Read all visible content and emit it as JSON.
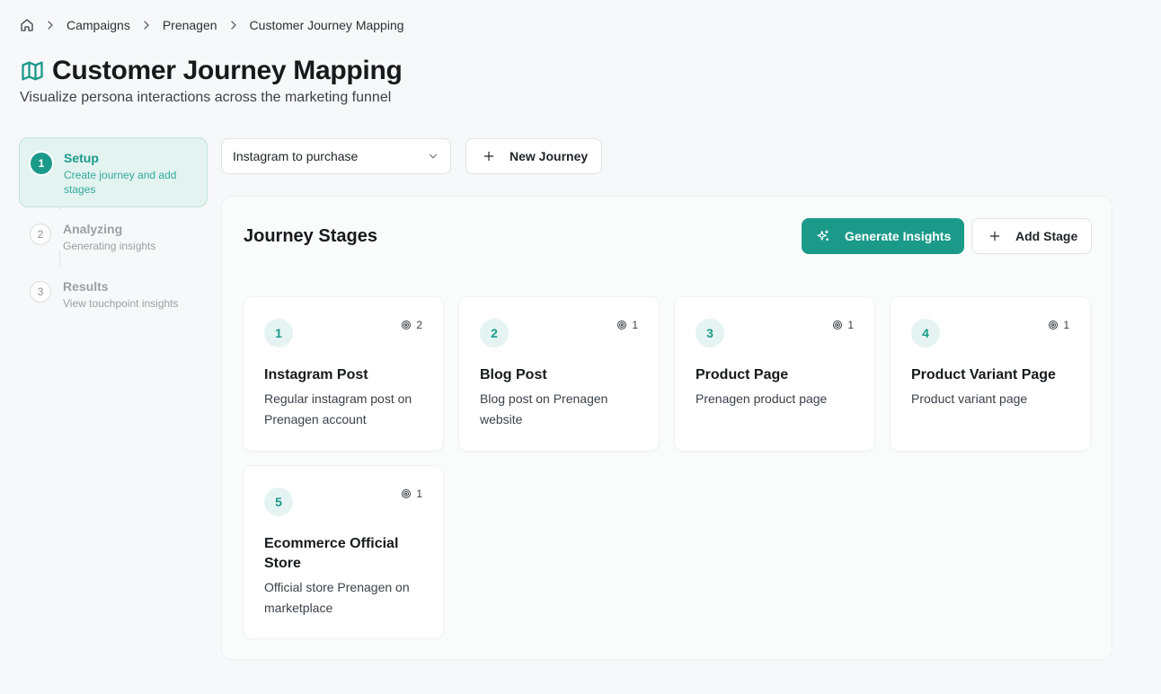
{
  "breadcrumb": {
    "home_icon": "home-icon",
    "items": [
      "Campaigns",
      "Prenagen",
      "Customer Journey Mapping"
    ]
  },
  "header": {
    "icon": "map-icon",
    "title": "Customer Journey Mapping",
    "subtitle": "Visualize persona interactions across the marketing funnel"
  },
  "stepper": {
    "steps": [
      {
        "number": "1",
        "label": "Setup",
        "description": "Create journey and add stages",
        "state": "active"
      },
      {
        "number": "2",
        "label": "Analyzing",
        "description": "Generating insights",
        "state": "pending"
      },
      {
        "number": "3",
        "label": "Results",
        "description": "View touchpoint insights",
        "state": "pending"
      }
    ]
  },
  "controls": {
    "journey_select_value": "Instagram to purchase",
    "new_journey_label": "New Journey"
  },
  "panel": {
    "title": "Journey Stages",
    "generate_insights_label": "Generate Insights",
    "add_stage_label": "Add Stage"
  },
  "stages": [
    {
      "number": "1",
      "count": "2",
      "title": "Instagram Post",
      "description": "Regular instagram post on Prenagen account"
    },
    {
      "number": "2",
      "count": "1",
      "title": "Blog Post",
      "description": "Blog post on Prenagen website"
    },
    {
      "number": "3",
      "count": "1",
      "title": "Product Page",
      "description": "Prenagen product page"
    },
    {
      "number": "4",
      "count": "1",
      "title": "Product Variant Page",
      "description": "Product variant page"
    },
    {
      "number": "5",
      "count": "1",
      "title": "Ecommerce Official Store",
      "description": "Official store Prenagen on marketplace"
    }
  ],
  "colors": {
    "accent": "#1b9a8a",
    "accent_light": "#e3f3f0",
    "background": "#f7f8f9"
  }
}
